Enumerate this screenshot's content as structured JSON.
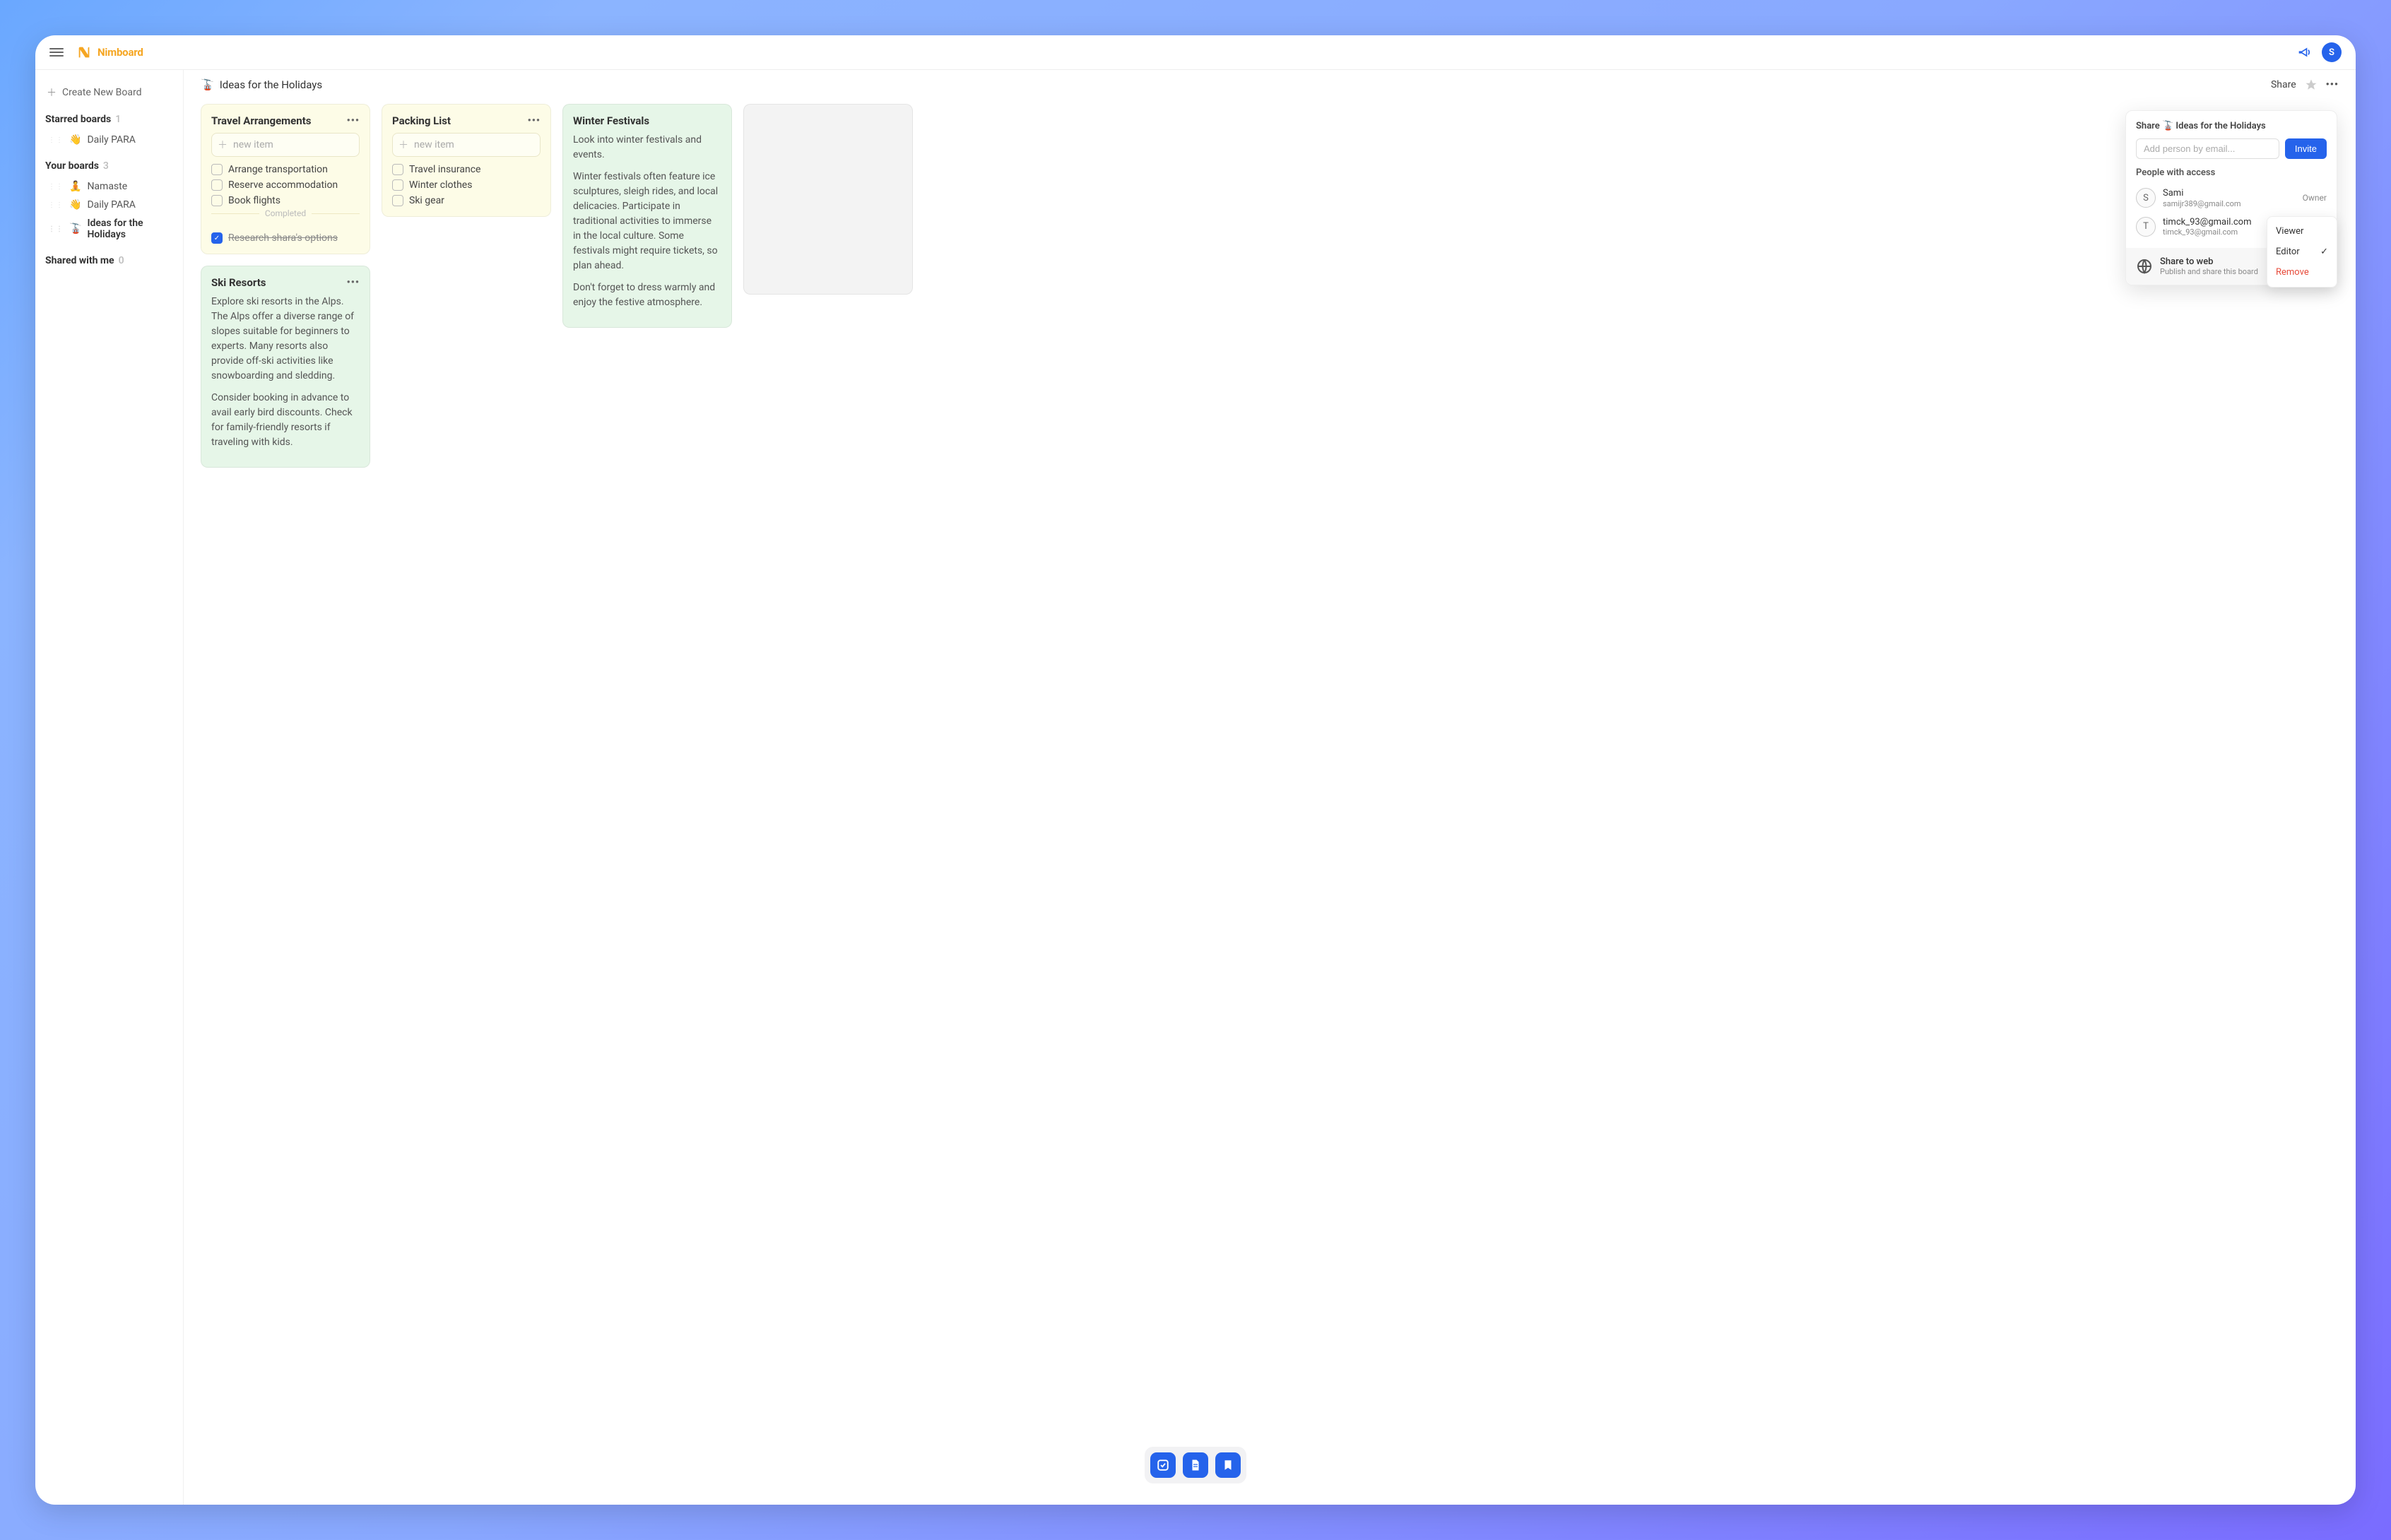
{
  "app": {
    "name": "Nimboard",
    "avatar_initial": "S"
  },
  "sidebar": {
    "create_label": "Create New Board",
    "starred": {
      "label": "Starred boards",
      "count": "1",
      "items": [
        {
          "emoji": "👋",
          "label": "Daily PARA"
        }
      ]
    },
    "your": {
      "label": "Your boards",
      "count": "3",
      "items": [
        {
          "emoji": "🧘",
          "label": "Namaste"
        },
        {
          "emoji": "👋",
          "label": "Daily PARA"
        },
        {
          "emoji": "🚡",
          "label": "Ideas for the Holidays",
          "active": true
        }
      ]
    },
    "shared": {
      "label": "Shared with me",
      "count": "0"
    }
  },
  "page": {
    "emoji": "🚡",
    "title": "Ideas for the Holidays",
    "share_label": "Share"
  },
  "cards": {
    "travel": {
      "title": "Travel Arrangements",
      "new_item": "new item",
      "items": [
        "Arrange transportation",
        "Reserve accommodation",
        "Book flights"
      ],
      "completed_label": "Completed",
      "completed_items": [
        "Research shara's options"
      ]
    },
    "packing": {
      "title": "Packing List",
      "new_item": "new item",
      "items": [
        "Travel insurance",
        "Winter clothes",
        "Ski gear"
      ]
    },
    "festivals": {
      "title": "Winter Festivals",
      "p1": "Look into winter festivals and events.",
      "p2": "Winter festivals often feature ice sculptures, sleigh rides, and local delicacies. Participate in traditional activities to immerse in the local culture. Some festivals might require tickets, so plan ahead.",
      "p3": "Don't forget to dress warmly and enjoy the festive atmosphere."
    },
    "ski": {
      "title": "Ski Resorts",
      "p1": "Explore ski resorts in the Alps. The Alps offer a diverse range of slopes suitable for beginners to experts. Many resorts also provide off-ski activities like snowboarding and sledding.",
      "p2": "Consider booking in advance to avail early bird discounts. Check for family-friendly resorts if traveling with kids."
    }
  },
  "share_panel": {
    "title_prefix": "Share",
    "title_emoji": "🚡",
    "title_board": "Ideas for the Holidays",
    "input_placeholder": "Add person by email...",
    "invite_label": "Invite",
    "access_label": "People with access",
    "people": [
      {
        "initial": "S",
        "name": "Sami",
        "email": "samijr389@gmail.com",
        "role": "Owner"
      },
      {
        "initial": "T",
        "name": "timck_93@gmail.com",
        "email": "timck_93@gmail.com",
        "role": "Editor"
      }
    ],
    "web": {
      "title": "Share to web",
      "sub": "Publish and share this board"
    }
  },
  "dropdown": {
    "viewer": "Viewer",
    "editor": "Editor",
    "remove": "Remove"
  }
}
